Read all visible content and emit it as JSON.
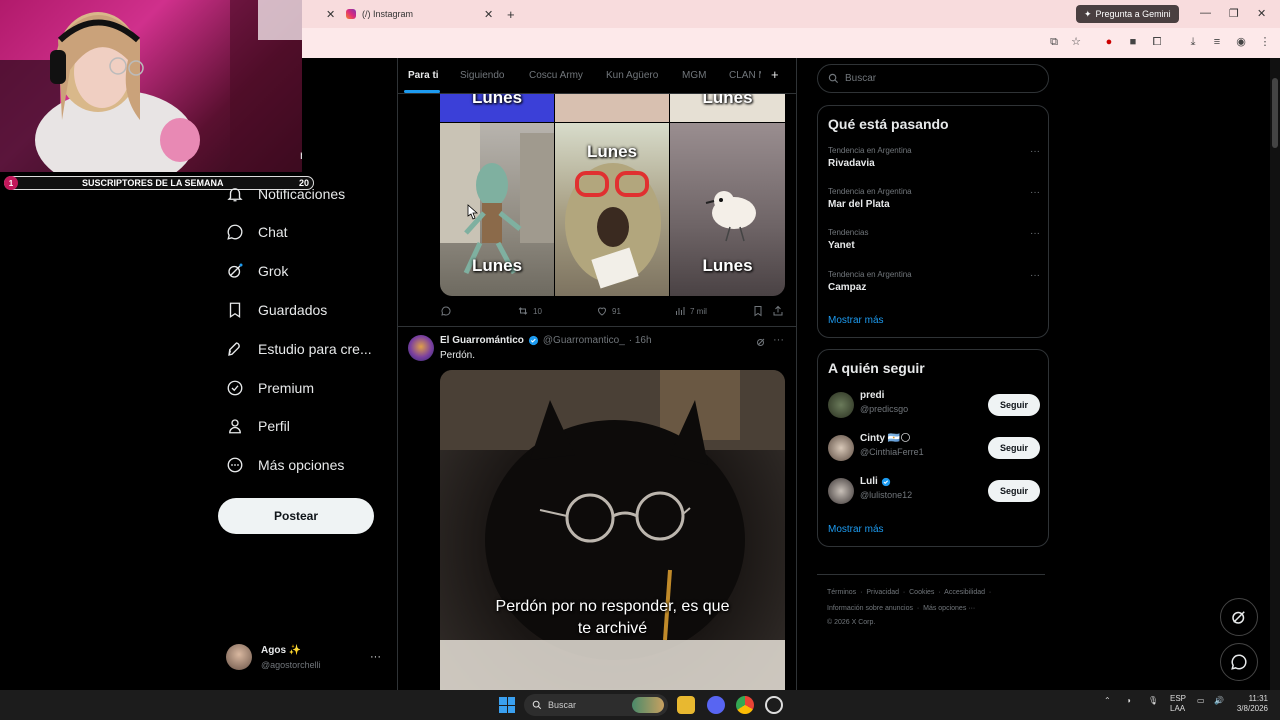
{
  "browser": {
    "tab_title": "(/) Instagram",
    "new_tab": "+",
    "gemini_label": "Pregunta a Gemini"
  },
  "overlay": {
    "subs_banner": "SUSCRIPTORES DE LA SEMANA",
    "subs_left": "1",
    "subs_right": "20",
    "partial_text": "r"
  },
  "sidebar": {
    "items": [
      {
        "label": "Notificaciones",
        "icon": "bell-icon"
      },
      {
        "label": "Chat",
        "icon": "chat-icon"
      },
      {
        "label": "Grok",
        "icon": "grok-icon"
      },
      {
        "label": "Guardados",
        "icon": "bookmark-icon"
      },
      {
        "label": "Estudio para cre...",
        "icon": "rocket-icon"
      },
      {
        "label": "Premium",
        "icon": "verified-icon"
      },
      {
        "label": "Perfil",
        "icon": "person-icon"
      },
      {
        "label": "Más opciones",
        "icon": "more-circle-icon"
      }
    ],
    "post_button": "Postear",
    "user_name": "Agos ✨",
    "user_handle": "@agostorchelli",
    "user_more": "···"
  },
  "feed": {
    "tabs": [
      "Para ti",
      "Siguiendo",
      "Coscu Army",
      "Kun Agüero",
      "MGM",
      "CLAN M"
    ],
    "add_tab": "+",
    "post1": {
      "image_labels": [
        "Lunes",
        "Lunes",
        "Lunes",
        "Lunes",
        "Lunes",
        "Lunes"
      ],
      "retweets": "10",
      "likes": "91",
      "views": "7 mil"
    },
    "post2": {
      "author": "El Guarromántico",
      "handle": "@Guarromantico_",
      "time": "· 16h",
      "text": "Perdón.",
      "caption_line1": "Perdón por no responder, es que",
      "caption_line2": "te archivé",
      "more": "···"
    }
  },
  "right": {
    "search_placeholder": "Buscar",
    "trends_title": "Qué está pasando",
    "trends": [
      {
        "context": "Tendencia en Argentina",
        "name": "Rivadavia"
      },
      {
        "context": "Tendencia en Argentina",
        "name": "Mar del Plata"
      },
      {
        "context": "Tendencias",
        "name": "Yanet"
      },
      {
        "context": "Tendencia en Argentina",
        "name": "Campaz"
      }
    ],
    "trend_more": "···",
    "show_more": "Mostrar más",
    "follow_title": "A quién seguir",
    "follow": [
      {
        "name": "predi",
        "handle": "@predicsgo",
        "button": "Seguir"
      },
      {
        "name": "Cinty 🇦🇷🌕",
        "handle": "@CinthiaFerre1",
        "button": "Seguir"
      },
      {
        "name": "Luli",
        "handle": "@lulistone12",
        "button": "Seguir"
      }
    ],
    "show_more2": "Mostrar más",
    "footer_line1": [
      "Términos",
      "Privacidad",
      "Cookies",
      "Accesibilidad"
    ],
    "footer_line2": [
      "Información sobre anuncios",
      "Más opciones ···"
    ],
    "copyright": "© 2026 X Corp."
  },
  "taskbar": {
    "search": "Buscar",
    "lang1": "ESP",
    "lang2": "LAA",
    "time": "11:31",
    "date": "3/8/2026"
  },
  "colors": {
    "accent": "#1d9bf0",
    "background": "#000000",
    "border": "#2f3336",
    "tabbar": "#f8dcdd"
  }
}
